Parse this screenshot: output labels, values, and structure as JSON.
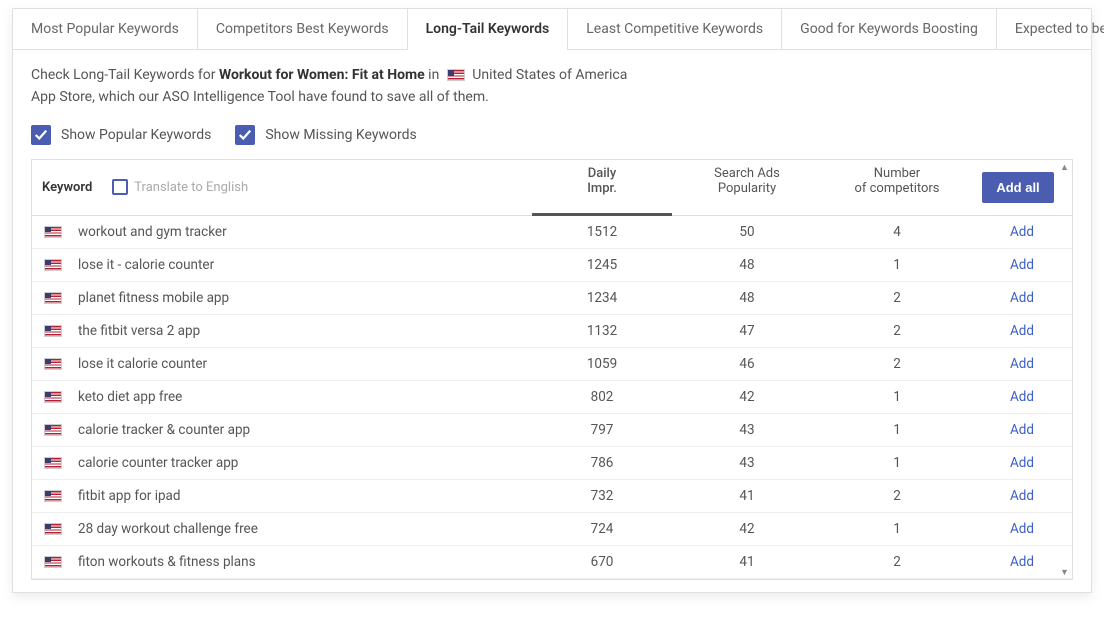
{
  "tabs": [
    {
      "label": "Most Popular Keywords",
      "active": false
    },
    {
      "label": "Competitors Best Keywords",
      "active": false
    },
    {
      "label": "Long-Tail Keywords",
      "active": true
    },
    {
      "label": "Least Competitive Keywords",
      "active": false
    },
    {
      "label": "Good for Keywords Boosting",
      "active": false
    },
    {
      "label": "Expected to be Trending",
      "active": false
    }
  ],
  "description": {
    "prefix": "Check Long-Tail Keywords for ",
    "app_name": "Workout for Women: Fit at Home",
    "in_text": " in ",
    "country": "United States of America",
    "line2": "App Store, which our ASO Intelligence Tool have found to save all of them."
  },
  "filters": {
    "show_popular": "Show Popular Keywords",
    "show_missing": "Show Missing Keywords"
  },
  "table": {
    "headers": {
      "keyword": "Keyword",
      "translate": "Translate to English",
      "daily_impr_l1": "Daily",
      "daily_impr_l2": "Impr.",
      "sap_l1": "Search Ads",
      "sap_l2": "Popularity",
      "noc_l1": "Number",
      "noc_l2": "of competitors",
      "add_all": "Add all",
      "add": "Add"
    },
    "rows": [
      {
        "kw": "workout and gym tracker",
        "di": "1512",
        "sap": "50",
        "noc": "4"
      },
      {
        "kw": "lose it - calorie counter",
        "di": "1245",
        "sap": "48",
        "noc": "1"
      },
      {
        "kw": "planet fitness mobile app",
        "di": "1234",
        "sap": "48",
        "noc": "2"
      },
      {
        "kw": "the fitbit versa 2 app",
        "di": "1132",
        "sap": "47",
        "noc": "2"
      },
      {
        "kw": "lose it calorie counter",
        "di": "1059",
        "sap": "46",
        "noc": "2"
      },
      {
        "kw": "keto diet app free",
        "di": "802",
        "sap": "42",
        "noc": "1"
      },
      {
        "kw": "calorie tracker & counter app",
        "di": "797",
        "sap": "43",
        "noc": "1"
      },
      {
        "kw": "calorie counter tracker app",
        "di": "786",
        "sap": "43",
        "noc": "1"
      },
      {
        "kw": "fitbit app for ipad",
        "di": "732",
        "sap": "41",
        "noc": "2"
      },
      {
        "kw": "28 day workout challenge free",
        "di": "724",
        "sap": "42",
        "noc": "1"
      },
      {
        "kw": "fiton workouts & fitness plans",
        "di": "670",
        "sap": "41",
        "noc": "2"
      }
    ]
  }
}
